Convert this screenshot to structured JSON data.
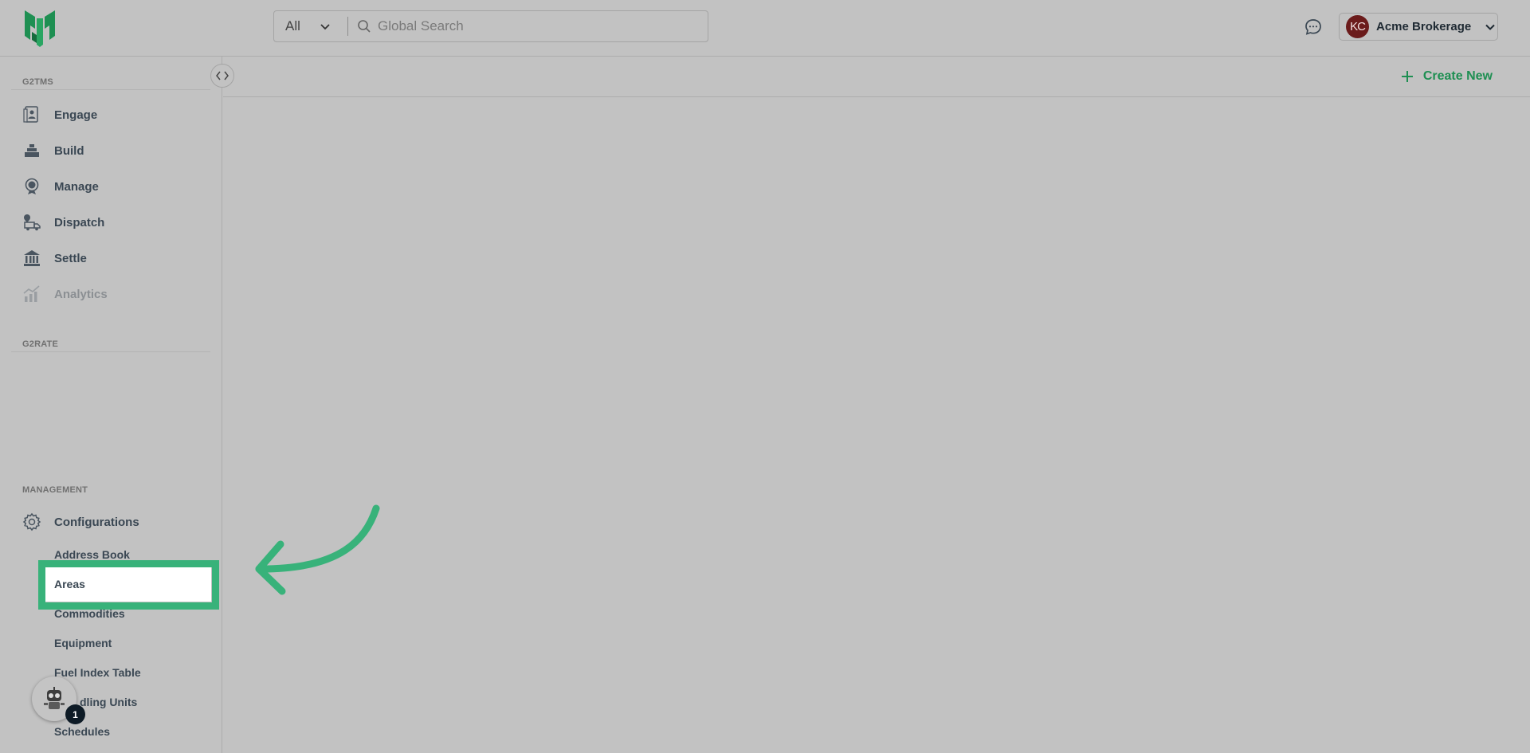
{
  "header": {
    "search_scope": "All",
    "search_placeholder": "Global Search",
    "account_initials": "KC",
    "account_name": "Acme Brokerage"
  },
  "sidebar": {
    "section_g2tms": "G2TMS",
    "nav": [
      {
        "label": "Engage",
        "icon": "engage-icon"
      },
      {
        "label": "Build",
        "icon": "build-icon"
      },
      {
        "label": "Manage",
        "icon": "manage-icon"
      },
      {
        "label": "Dispatch",
        "icon": "dispatch-icon"
      },
      {
        "label": "Settle",
        "icon": "settle-icon"
      },
      {
        "label": "Analytics",
        "icon": "analytics-icon"
      }
    ],
    "section_g2rate": "G2RATE",
    "section_management": "MANAGEMENT",
    "configurations": "Configurations",
    "config_items": [
      "Address Book",
      "Areas",
      "Commodities",
      "Equipment",
      "Fuel Index Table",
      "dling Units",
      "Schedules"
    ]
  },
  "toolbar": {
    "create_new": "Create New"
  },
  "assistant": {
    "badge_count": "1"
  },
  "colors": {
    "brand_green": "#1e8f52",
    "highlight_green": "#38b27a",
    "avatar_bg": "#6b1b1b"
  }
}
